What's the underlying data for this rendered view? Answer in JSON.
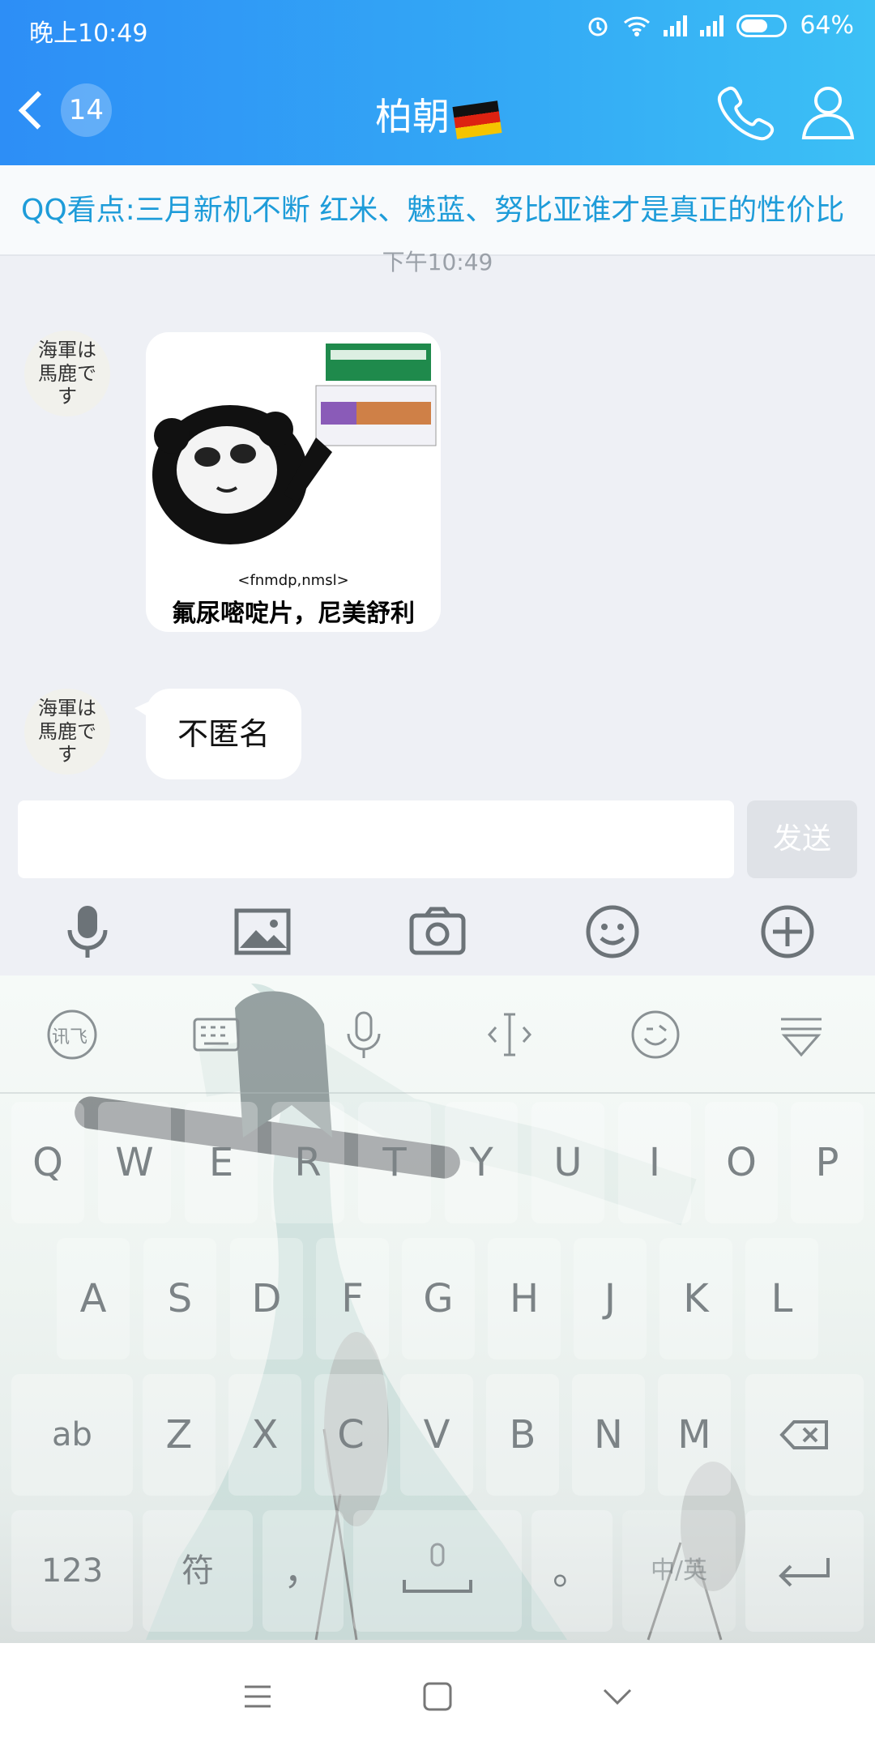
{
  "status": {
    "time": "晚上10:49",
    "battery": "64%",
    "battery_level": 0.64
  },
  "header": {
    "unread_count": "14",
    "title": "柏朝"
  },
  "banner": {
    "text": "QQ看点:三月新机不断 红米、魅蓝、努比亚谁才是真正的性价比"
  },
  "chat": {
    "time": "下午10:49",
    "avatar_text": "海軍は馬鹿です",
    "sticker": {
      "caption_small": "<fnmdp,nmsl>",
      "caption_main": "氟尿嘧啶片，尼美舒利"
    },
    "message": "不匿名"
  },
  "composer": {
    "placeholder": "",
    "send_label": "发送"
  },
  "toolbar": {
    "icons": [
      "microphone-icon",
      "image-icon",
      "camera-icon",
      "emoji-icon",
      "plus-icon"
    ]
  },
  "keyboard": {
    "brand": "讯飞",
    "row1": [
      "Q",
      "W",
      "E",
      "R",
      "T",
      "Y",
      "U",
      "I",
      "O",
      "P"
    ],
    "row2": [
      "A",
      "S",
      "D",
      "F",
      "G",
      "H",
      "J",
      "K",
      "L"
    ],
    "row3": [
      "Z",
      "X",
      "C",
      "V",
      "B",
      "N",
      "M"
    ],
    "shift": "ab",
    "num": "123",
    "sym": "符",
    "comma": "，",
    "period": "。",
    "lang": "中/英"
  }
}
